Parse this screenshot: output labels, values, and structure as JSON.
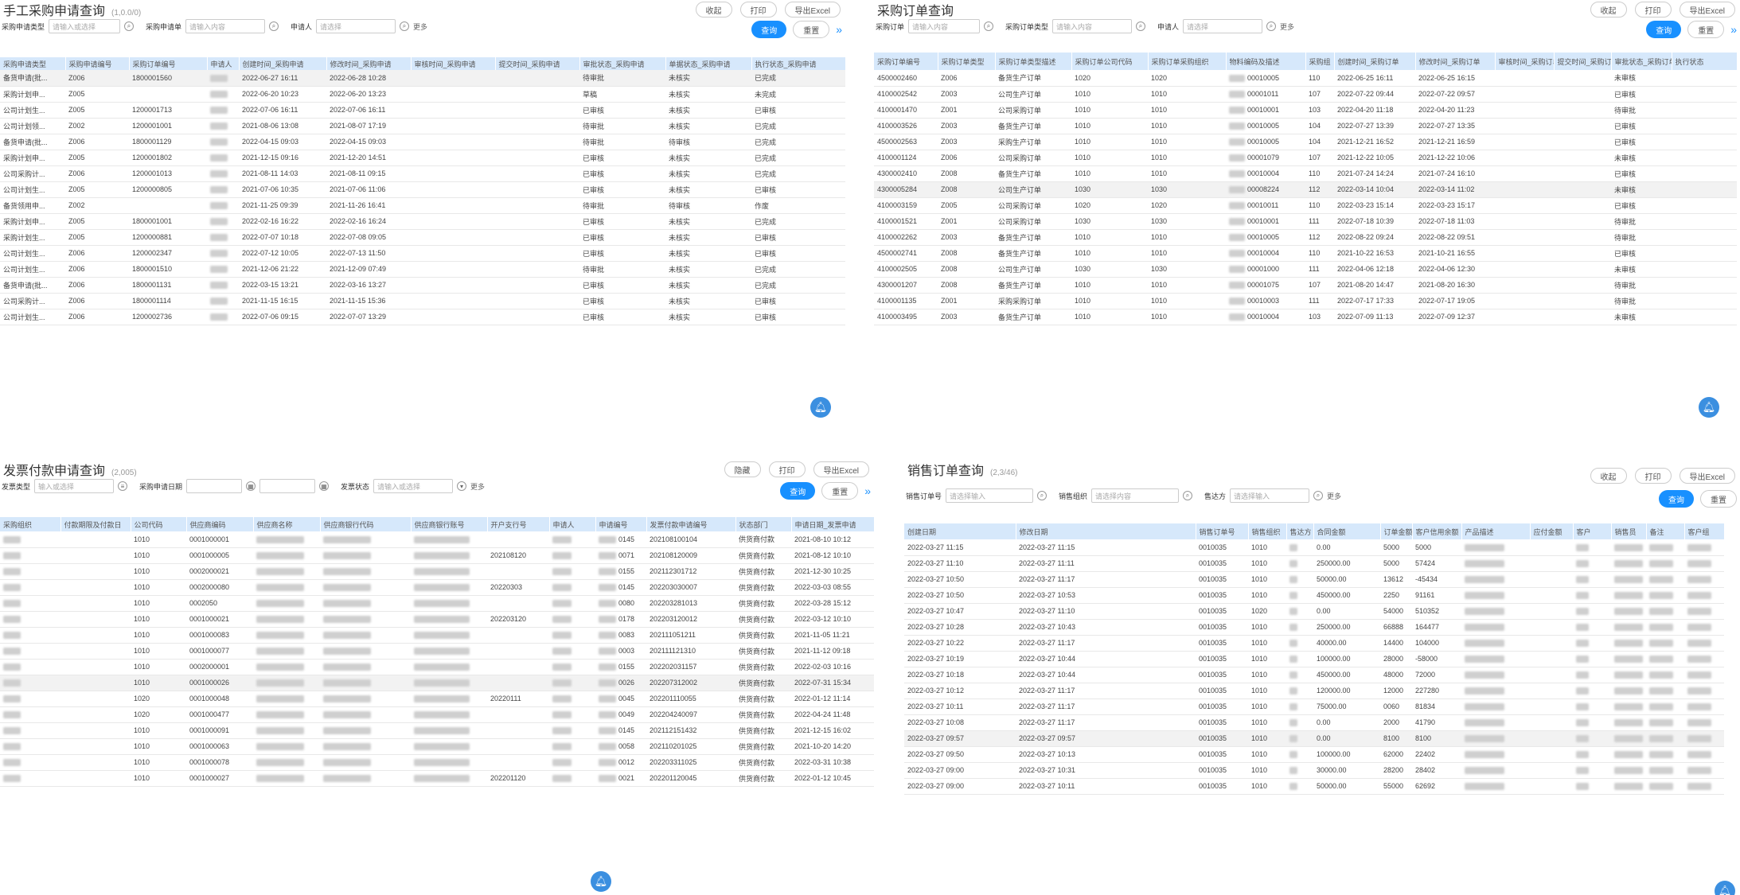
{
  "colors": {
    "primary": "#1890ff",
    "header": "#d6e8fb"
  },
  "panel1": {
    "title": "手工采购申请查询",
    "count": "(1,0.0/0)",
    "buttons": [
      "收起",
      "打印",
      "导出Excel"
    ],
    "filters": [
      {
        "label": "采购申请类型",
        "placeholder": "请输入或选择"
      },
      {
        "label": "采购申请单",
        "placeholder": "请输入内容"
      },
      {
        "label": "申请人",
        "placeholder": "请选择"
      }
    ],
    "more": "更多",
    "query": "查询",
    "reset": "重置",
    "columns": [
      "采购申请类型",
      "采购申请编号",
      "采购订单编号",
      "申请人",
      "创建时间_采购申请",
      "修改时间_采购申请",
      "审核时间_采购申请",
      "提交时间_采购申请",
      "审批状态_采购申请",
      "单据状态_采购申请",
      "执行状态_采购申请"
    ],
    "rows": [
      [
        "备货申请(批...",
        "Z006",
        "1800001560",
        "",
        "2022-06-27 16:11",
        "2022-06-28 10:28",
        "",
        "",
        "待审批",
        "未核实",
        "已完成"
      ],
      [
        "采购计划申...",
        "Z005",
        "",
        "",
        "2022-06-20 10:23",
        "2022-06-20 13:23",
        "",
        "",
        "草稿",
        "未核实",
        "未完成"
      ],
      [
        "公司计划生...",
        "Z005",
        "1200001713",
        "",
        "2022-07-06 16:11",
        "2022-07-06 16:11",
        "",
        "",
        "已审核",
        "未核实",
        "已审核"
      ],
      [
        "公司计划领...",
        "Z002",
        "1200001001",
        "",
        "2021-08-06 13:08",
        "2021-08-07 17:19",
        "",
        "",
        "待审批",
        "未核实",
        "已完成"
      ],
      [
        "备货申请(批...",
        "Z006",
        "1800001129",
        "",
        "2022-04-15 09:03",
        "2022-04-15 09:03",
        "",
        "",
        "待审批",
        "待审核",
        "已完成"
      ],
      [
        "采购计划申...",
        "Z005",
        "1200001802",
        "",
        "2021-12-15 09:16",
        "2021-12-20 14:51",
        "",
        "",
        "已审核",
        "未核实",
        "已完成"
      ],
      [
        "公司采购计...",
        "Z006",
        "1200001013",
        "",
        "2021-08-11 14:03",
        "2021-08-11 09:15",
        "",
        "",
        "已审核",
        "未核实",
        "已完成"
      ],
      [
        "公司计划生...",
        "Z005",
        "1200000805",
        "",
        "2021-07-06 10:35",
        "2021-07-06 11:06",
        "",
        "",
        "已审核",
        "未核实",
        "已审核"
      ],
      [
        "备货领用申...",
        "Z002",
        "",
        "",
        "2021-11-25 09:39",
        "2021-11-26 16:41",
        "",
        "",
        "待审批",
        "待审核",
        "作废"
      ],
      [
        "采购计划申...",
        "Z005",
        "1800001001",
        "",
        "2022-02-16 16:22",
        "2022-02-16 16:24",
        "",
        "",
        "已审核",
        "未核实",
        "已完成"
      ],
      [
        "采购计划生...",
        "Z005",
        "1200000881",
        "",
        "2022-07-07 10:18",
        "2022-07-08 09:05",
        "",
        "",
        "已审核",
        "未核实",
        "已审核"
      ],
      [
        "公司计划生...",
        "Z006",
        "1200002347",
        "",
        "2022-07-12 10:05",
        "2022-07-13 11:50",
        "",
        "",
        "已审核",
        "未核实",
        "已审核"
      ],
      [
        "公司计划生...",
        "Z006",
        "1800001510",
        "",
        "2021-12-06 21:22",
        "2021-12-09 07:49",
        "",
        "",
        "待审批",
        "未核实",
        "已完成"
      ],
      [
        "备货申请(批...",
        "Z006",
        "1800001131",
        "",
        "2022-03-15 13:21",
        "2022-03-16 13:27",
        "",
        "",
        "已审核",
        "未核实",
        "已完成"
      ],
      [
        "公司采购计...",
        "Z006",
        "1800001114",
        "",
        "2021-11-15 16:15",
        "2021-11-15 15:36",
        "",
        "",
        "已审核",
        "未核实",
        "已审核"
      ],
      [
        "公司计划生...",
        "Z006",
        "1200002736",
        "",
        "2022-07-06 09:15",
        "2022-07-07 13:29",
        "",
        "",
        "已审核",
        "未核实",
        "已审核"
      ]
    ]
  },
  "panel2": {
    "title": "采购订单查询",
    "count": "",
    "buttons": [
      "收起",
      "打印",
      "导出Excel"
    ],
    "filters": [
      {
        "label": "采购订单",
        "placeholder": "请输入内容"
      },
      {
        "label": "采购订单类型",
        "placeholder": "请输入内容"
      },
      {
        "label": "申请人",
        "placeholder": "请选择"
      }
    ],
    "more": "更多",
    "query": "查询",
    "reset": "重置",
    "columns": [
      "采购订单编号",
      "采购订单类型",
      "采购订单类型描述",
      "采购订单公司代码",
      "采购订单采购组织",
      "物料编码及描述",
      "采购组",
      "创建时间_采购订单",
      "修改时间_采购订单",
      "审核时间_采购订单",
      "提交时间_采购订单",
      "审批状态_采购订单",
      "执行状态"
    ],
    "rows": [
      [
        "4500002460",
        "Z006",
        "备货生产订单",
        "1020",
        "1020",
        "00010005",
        "110",
        "2022-06-25 16:11",
        "2022-06-25 16:15",
        "",
        "",
        "未审核",
        ""
      ],
      [
        "4100002542",
        "Z003",
        "公司生产订单",
        "1010",
        "1010",
        "00001011",
        "107",
        "2022-07-22 09:44",
        "2022-07-22 09:57",
        "",
        "",
        "已审核",
        ""
      ],
      [
        "4100001470",
        "Z001",
        "公司采购订单",
        "1010",
        "1010",
        "00010001",
        "103",
        "2022-04-20 11:18",
        "2022-04-20 11:23",
        "",
        "",
        "待审批",
        ""
      ],
      [
        "4100003526",
        "Z003",
        "备货生产订单",
        "1010",
        "1010",
        "00010005",
        "104",
        "2022-07-27 13:39",
        "2022-07-27 13:35",
        "",
        "",
        "已审核",
        ""
      ],
      [
        "4500002563",
        "Z003",
        "采购生产订单",
        "1010",
        "1010",
        "00010005",
        "104",
        "2021-12-21 16:52",
        "2021-12-21 16:59",
        "",
        "",
        "已审核",
        ""
      ],
      [
        "4100001124",
        "Z006",
        "公司采购订单",
        "1010",
        "1010",
        "00001079",
        "107",
        "2021-12-22 10:05",
        "2021-12-22 10:06",
        "",
        "",
        "未审核",
        ""
      ],
      [
        "4300002410",
        "Z008",
        "备货生产订单",
        "1010",
        "1010",
        "00010004",
        "110",
        "2021-07-24 14:24",
        "2021-07-24 16:10",
        "",
        "",
        "已审核",
        ""
      ],
      [
        "4300005284",
        "Z008",
        "公司生产订单",
        "1030",
        "1030",
        "00008224",
        "112",
        "2022-03-14 10:04",
        "2022-03-14 11:02",
        "",
        "",
        "未审核",
        ""
      ],
      [
        "4100003159",
        "Z005",
        "公司采购订单",
        "1020",
        "1020",
        "00010011",
        "110",
        "2022-03-23 15:14",
        "2022-03-23 15:17",
        "",
        "",
        "已审核",
        ""
      ],
      [
        "4100001521",
        "Z001",
        "公司采购订单",
        "1030",
        "1030",
        "00010001",
        "111",
        "2022-07-18 10:39",
        "2022-07-18 11:03",
        "",
        "",
        "待审批",
        ""
      ],
      [
        "4100002262",
        "Z003",
        "备货生产订单",
        "1010",
        "1010",
        "00010005",
        "112",
        "2022-08-22 09:24",
        "2022-08-22 09:51",
        "",
        "",
        "待审批",
        ""
      ],
      [
        "4500002741",
        "Z008",
        "备货生产订单",
        "1010",
        "1010",
        "00010004",
        "110",
        "2021-10-22 16:53",
        "2021-10-21 16:55",
        "",
        "",
        "已审核",
        ""
      ],
      [
        "4100002505",
        "Z008",
        "公司生产订单",
        "1030",
        "1030",
        "00001000",
        "111",
        "2022-04-06 12:18",
        "2022-04-06 12:30",
        "",
        "",
        "未审核",
        ""
      ],
      [
        "4300001207",
        "Z008",
        "备货生产订单",
        "1010",
        "1010",
        "00001075",
        "107",
        "2021-08-20 14:47",
        "2021-08-20 16:30",
        "",
        "",
        "待审批",
        ""
      ],
      [
        "4100001135",
        "Z001",
        "采购采购订单",
        "1010",
        "1010",
        "00010003",
        "111",
        "2022-07-17 17:33",
        "2022-07-17 19:05",
        "",
        "",
        "待审批",
        ""
      ],
      [
        "4100003495",
        "Z003",
        "备货生产订单",
        "1010",
        "1010",
        "00010004",
        "103",
        "2022-07-09 11:13",
        "2022-07-09 12:37",
        "",
        "",
        "未审核",
        ""
      ]
    ]
  },
  "panel3": {
    "title": "发票付款申请查询",
    "count": "(2,005)",
    "buttons": [
      "隐藏",
      "打印",
      "导出Excel"
    ],
    "filters": [
      {
        "label": "发票类型",
        "placeholder": "输入或选择"
      },
      {
        "label": "采购申请日期",
        "placeholder": ""
      },
      {
        "label": "",
        "placeholder": ""
      },
      {
        "label": "发票状态",
        "placeholder": "请输入或选择"
      }
    ],
    "more": "更多",
    "query": "查询",
    "reset": "重置",
    "columns": [
      "采购组织",
      "付款期限及付款日",
      "公司代码",
      "供应商编码",
      "供应商名称",
      "供应商银行代码",
      "供应商银行账号",
      "开户支行号",
      "申请人",
      "申请编号",
      "发票付款申请编号",
      "状态部门",
      "申请日期_发票申请"
    ],
    "rows": [
      [
        "",
        "",
        "1010",
        "0001000001",
        "",
        "",
        "",
        "",
        "",
        "0145",
        "202108100104",
        "供货商付款",
        "2021-08-10 10:12"
      ],
      [
        "",
        "",
        "1010",
        "0001000005",
        "",
        "",
        "",
        "202108120",
        "",
        "0071",
        "202108120009",
        "供货商付款",
        "2021-08-12 10:10"
      ],
      [
        "",
        "",
        "1010",
        "0002000021",
        "",
        "",
        "",
        "",
        "",
        "0155",
        "202112301712",
        "供货商付款",
        "2021-12-30 10:25"
      ],
      [
        "",
        "",
        "1010",
        "0002000080",
        "",
        "",
        "",
        "20220303",
        "",
        "0145",
        "202203030007",
        "供货商付款",
        "2022-03-03 08:55"
      ],
      [
        "",
        "",
        "1010",
        "0002050",
        "",
        "",
        "",
        "",
        "",
        "0080",
        "202203281013",
        "供货商付款",
        "2022-03-28 15:12"
      ],
      [
        "",
        "",
        "1010",
        "0001000021",
        "",
        "",
        "",
        "202203120",
        "",
        "0178",
        "202203120012",
        "供货商付款",
        "2022-03-12 10:10"
      ],
      [
        "",
        "",
        "1010",
        "0001000083",
        "",
        "",
        "",
        "",
        "",
        "0083",
        "202111051211",
        "供货商付款",
        "2021-11-05 11:21"
      ],
      [
        "",
        "",
        "1010",
        "0001000077",
        "",
        "",
        "",
        "",
        "",
        "0003",
        "202111121310",
        "供货商付款",
        "2021-11-12 09:18"
      ],
      [
        "",
        "",
        "1010",
        "0002000001",
        "",
        "",
        "",
        "",
        "",
        "0155",
        "202202031157",
        "供货商付款",
        "2022-02-03 10:16"
      ],
      [
        "",
        "",
        "1010",
        "0001000026",
        "",
        "",
        "",
        "",
        "",
        "0026",
        "202207312002",
        "供货商付款",
        "2022-07-31 15:34"
      ],
      [
        "",
        "",
        "1020",
        "0001000048",
        "",
        "",
        "",
        "20220111",
        "",
        "0045",
        "202201110055",
        "供货商付款",
        "2022-01-12 11:14"
      ],
      [
        "",
        "",
        "1020",
        "0001000477",
        "",
        "",
        "",
        "",
        "",
        "0049",
        "202204240097",
        "供货商付款",
        "2022-04-24 11:48"
      ],
      [
        "",
        "",
        "1010",
        "0001000091",
        "",
        "",
        "",
        "",
        "",
        "0145",
        "202112151432",
        "供货商付款",
        "2021-12-15 16:02"
      ],
      [
        "",
        "",
        "1010",
        "0001000063",
        "",
        "",
        "",
        "",
        "",
        "0058",
        "202110201025",
        "供货商付款",
        "2021-10-20 14:20"
      ],
      [
        "",
        "",
        "1010",
        "0001000078",
        "",
        "",
        "",
        "",
        "",
        "0012",
        "202203311025",
        "供货商付款",
        "2022-03-31 10:38"
      ],
      [
        "",
        "",
        "1010",
        "0001000027",
        "",
        "",
        "",
        "202201120",
        "",
        "0021",
        "202201120045",
        "供货商付款",
        "2022-01-12 10:45"
      ]
    ]
  },
  "panel4": {
    "title": "销售订单查询",
    "count": "(2,3/46)",
    "buttons": [
      "收起",
      "打印",
      "导出Excel"
    ],
    "filters": [
      {
        "label": "销售订单号",
        "placeholder": "请选择输入"
      },
      {
        "label": "销售组织",
        "placeholder": "请选择内容"
      },
      {
        "label": "售达方",
        "placeholder": "请选择输入"
      }
    ],
    "more": "更多",
    "query": "查询",
    "reset": "重置",
    "columns": [
      "创建日期",
      "修改日期",
      "销售订单号",
      "销售组织",
      "售达方",
      "合同金额",
      "订单金额",
      "客户信用余额",
      "产品描述",
      "应付金额",
      "客户",
      "销售员",
      "备注",
      "客户组"
    ],
    "rows": [
      [
        "2022-03-27 11:15",
        "2022-03-27 11:15",
        "0010035",
        "1010",
        "",
        "0.00",
        "5000",
        "5000",
        "",
        "",
        "",
        "",
        "",
        ""
      ],
      [
        "2022-03-27 11:10",
        "2022-03-27 11:11",
        "0010035",
        "1010",
        "",
        "250000.00",
        "5000",
        "57424",
        "",
        "",
        "",
        "",
        "",
        ""
      ],
      [
        "2022-03-27 10:50",
        "2022-03-27 11:17",
        "0010035",
        "1010",
        "",
        "50000.00",
        "13612",
        "-45434",
        "",
        "",
        "",
        "",
        "",
        ""
      ],
      [
        "2022-03-27 10:50",
        "2022-03-27 10:53",
        "0010035",
        "1010",
        "",
        "450000.00",
        "2250",
        "91161",
        "",
        "",
        "",
        "",
        "",
        ""
      ],
      [
        "2022-03-27 10:47",
        "2022-03-27 11:10",
        "0010035",
        "1020",
        "",
        "0.00",
        "54000",
        "510352",
        "",
        "",
        "",
        "",
        "",
        ""
      ],
      [
        "2022-03-27 10:28",
        "2022-03-27 10:43",
        "0010035",
        "1010",
        "",
        "250000.00",
        "66888",
        "164477",
        "",
        "",
        "",
        "",
        "",
        ""
      ],
      [
        "2022-03-27 10:22",
        "2022-03-27 11:17",
        "0010035",
        "1010",
        "",
        "40000.00",
        "14400",
        "104000",
        "",
        "",
        "",
        "",
        "",
        ""
      ],
      [
        "2022-03-27 10:19",
        "2022-03-27 10:44",
        "0010035",
        "1010",
        "",
        "100000.00",
        "28000",
        "-58000",
        "",
        "",
        "",
        "",
        "",
        ""
      ],
      [
        "2022-03-27 10:18",
        "2022-03-27 10:44",
        "0010035",
        "1010",
        "",
        "450000.00",
        "48000",
        "72000",
        "",
        "",
        "",
        "",
        "",
        ""
      ],
      [
        "2022-03-27 10:12",
        "2022-03-27 11:17",
        "0010035",
        "1010",
        "",
        "120000.00",
        "12000",
        "227280",
        "",
        "",
        "",
        "",
        "",
        ""
      ],
      [
        "2022-03-27 10:11",
        "2022-03-27 11:17",
        "0010035",
        "1010",
        "",
        "75000.00",
        "0060",
        "81834",
        "",
        "",
        "",
        "",
        "",
        ""
      ],
      [
        "2022-03-27 10:08",
        "2022-03-27 11:17",
        "0010035",
        "1010",
        "",
        "0.00",
        "2000",
        "41790",
        "",
        "",
        "",
        "",
        "",
        ""
      ],
      [
        "2022-03-27 09:57",
        "2022-03-27 09:57",
        "0010035",
        "1010",
        "",
        "0.00",
        "8100",
        "8100",
        "",
        "",
        "",
        "",
        "",
        ""
      ],
      [
        "2022-03-27 09:50",
        "2022-03-27 10:13",
        "0010035",
        "1010",
        "",
        "100000.00",
        "62000",
        "22402",
        "",
        "",
        "",
        "",
        "",
        ""
      ],
      [
        "2022-03-27 09:00",
        "2022-03-27 10:31",
        "0010035",
        "1010",
        "",
        "30000.00",
        "28200",
        "28402",
        "",
        "",
        "",
        "",
        "",
        ""
      ],
      [
        "2022-03-27 09:00",
        "2022-03-27 10:11",
        "0010035",
        "1010",
        "",
        "50000.00",
        "55000",
        "62692",
        "",
        "",
        "",
        "",
        "",
        ""
      ]
    ]
  }
}
